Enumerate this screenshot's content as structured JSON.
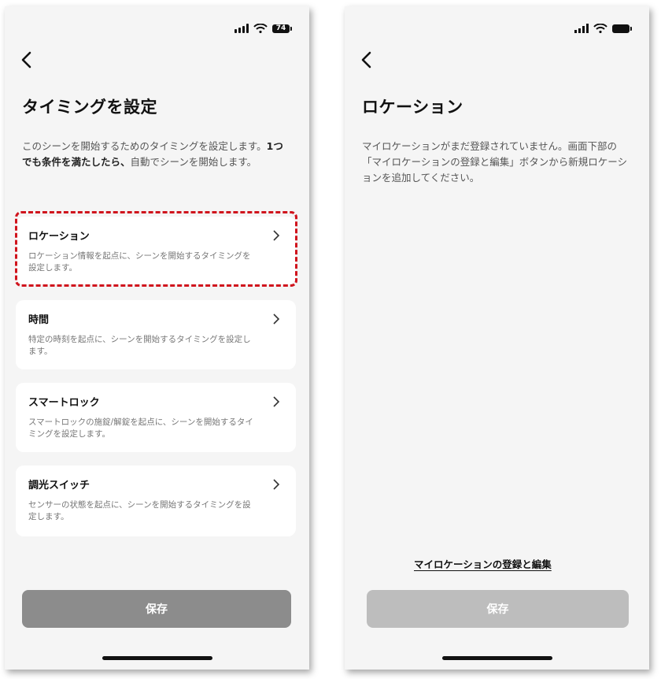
{
  "left_screen": {
    "status": {
      "battery": "74"
    },
    "title": "タイミングを設定",
    "description_part1": "このシーンを開始するためのタイミングを設定しま",
    "description_part2": "す。",
    "description_bold": "1つでも条件を満たしたら、",
    "description_part3": "自動でシーンを開始し",
    "description_part4": "ます。",
    "cards": [
      {
        "title": "ロケーション",
        "desc": "ロケーション情報を起点に、シーンを開始するタイミングを設定します。",
        "highlighted": true
      },
      {
        "title": "時間",
        "desc": "特定の時刻を起点に、シーンを開始するタイミングを設定します。",
        "highlighted": false
      },
      {
        "title": "スマートロック",
        "desc": "スマートロックの施錠/解錠を起点に、シーンを開始するタイミングを設定します。",
        "highlighted": false
      },
      {
        "title": "調光スイッチ",
        "desc": "センサーの状態を起点に、シーンを開始するタイミングを設定します。",
        "highlighted": false
      }
    ],
    "save_label": "保存"
  },
  "right_screen": {
    "title": "ロケーション",
    "message": "マイロケーションがまだ登録されていません。画面下部の「マイロケーションの登録と編集」ボタンから新規ロケーションを追加してください。",
    "link_label": "マイロケーションの登録と編集",
    "save_label": "保存"
  },
  "colors": {
    "highlight": "#d0141d",
    "save_left": "#8c8c8c",
    "save_right_disabled": "#bdbdbd"
  }
}
